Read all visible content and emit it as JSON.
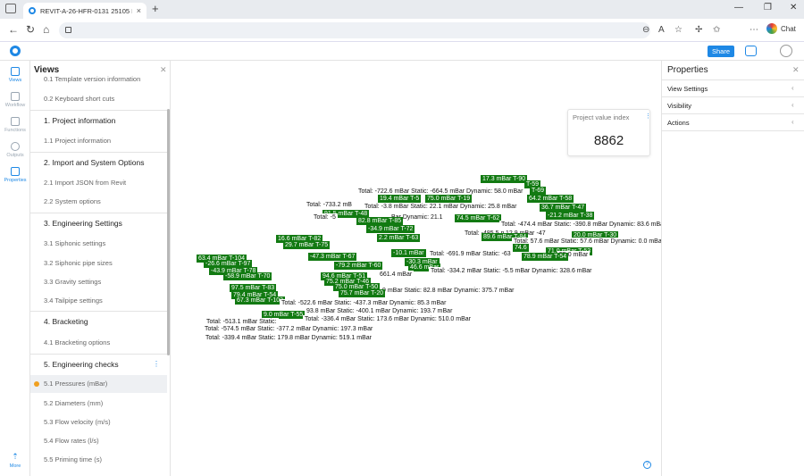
{
  "browser": {
    "tab_title": "REVIT-A-26-HFR-0131 25105 IGEB",
    "tab_close": "×",
    "new_tab": "+",
    "chat_label": "Chat"
  },
  "app": {
    "share_label": "Share"
  },
  "rail": [
    {
      "label": "Views",
      "active": true
    },
    {
      "label": "Workflow",
      "active": false
    },
    {
      "label": "Functions",
      "active": false
    },
    {
      "label": "Outputs",
      "active": false
    },
    {
      "label": "Properties",
      "active": true
    },
    {
      "label": "More",
      "active": true
    }
  ],
  "views": {
    "title": "Views",
    "items": [
      {
        "kind": "item",
        "label": "0.1 Template version information"
      },
      {
        "kind": "item",
        "label": "0.2 Keyboard short cuts"
      },
      {
        "kind": "section",
        "label": "1. Project information"
      },
      {
        "kind": "item",
        "label": "1.1 Project information"
      },
      {
        "kind": "section",
        "label": "2. Import and System Options"
      },
      {
        "kind": "item",
        "label": "2.1 Import JSON from Revit"
      },
      {
        "kind": "item",
        "label": "2.2 System options"
      },
      {
        "kind": "section",
        "label": "3. Engineering Settings"
      },
      {
        "kind": "item",
        "label": "3.1 Siphonic settings"
      },
      {
        "kind": "item",
        "label": "3.2 Siphonic pipe sizes"
      },
      {
        "kind": "item",
        "label": "3.3 Gravity settings"
      },
      {
        "kind": "item",
        "label": "3.4 Tailpipe settings"
      },
      {
        "kind": "section",
        "label": "4. Bracketing"
      },
      {
        "kind": "item",
        "label": "4.1 Bracketing options"
      },
      {
        "kind": "section",
        "label": "5. Engineering checks",
        "menu": true
      },
      {
        "kind": "item",
        "label": "5.1 Pressures (mBar)",
        "active": true
      },
      {
        "kind": "item",
        "label": "5.2 Diameters (mm)"
      },
      {
        "kind": "item",
        "label": "5.3 Flow velocity (m/s)"
      },
      {
        "kind": "item",
        "label": "5.4 Flow rates (l/s)"
      },
      {
        "kind": "item",
        "label": "5.5 Priming time (s)"
      }
    ]
  },
  "kpi": {
    "title": "Project value index",
    "value": "8862"
  },
  "properties": {
    "title": "Properties",
    "rows": [
      "View Settings",
      "Visibility",
      "Actions"
    ]
  },
  "canvas_labels": [
    {
      "t": "g",
      "text": "17.3 mBar T-90"
    },
    {
      "t": "g",
      "text": "T-59"
    },
    {
      "t": "w",
      "text": "Total: -722.6 mBar Static: -664.5 mBar Dynamic: 58.0 mBar"
    },
    {
      "t": "g",
      "text": "T-69"
    },
    {
      "t": "g",
      "text": "19.4 mBar T-5"
    },
    {
      "t": "g",
      "text": "75.0 mBar T-19"
    },
    {
      "t": "g",
      "text": "64.2 mBar T-58"
    },
    {
      "t": "w",
      "text": "Total: -733.2 mB"
    },
    {
      "t": "w",
      "text": "Total: -3.8 mBar Static: 22.1 mBar Dynamic: 25.8 mBar"
    },
    {
      "t": "g",
      "text": "36.7 mBar T-47"
    },
    {
      "t": "g",
      "text": "91.5 mBar T-48"
    },
    {
      "t": "g",
      "text": "-21.2 mBar T-38"
    },
    {
      "t": "w",
      "text": "Total: -5"
    },
    {
      "t": "w",
      "text": "Bar Dynamic: 21.1"
    },
    {
      "t": "g",
      "text": "74.5 mBar T-62"
    },
    {
      "t": "g",
      "text": "82.8 mBar T-85"
    },
    {
      "t": "w",
      "text": "Total: -474.4 mBar Static: -390.8 mBar Dynamic: 83.6 mBar"
    },
    {
      "t": "g",
      "text": "-34.9 mBar T-72"
    },
    {
      "t": "w",
      "text": "Total: -485.5 mBar Static: -47"
    },
    {
      "t": "w",
      "text": "12.9 mBar"
    },
    {
      "t": "g",
      "text": "20.0 mBar T-30"
    },
    {
      "t": "g",
      "text": "89.6 mBar T-84"
    },
    {
      "t": "g",
      "text": "2.2 mBar T-63"
    },
    {
      "t": "w",
      "text": "Total: 57.6 mBar Static: 57.6 mBar Dynamic: 0.0 mBar"
    },
    {
      "t": "g",
      "text": "16.6 mBar T-82"
    },
    {
      "t": "g",
      "text": "29.7 mBar T-75"
    },
    {
      "t": "g",
      "text": "74.6"
    },
    {
      "t": "g",
      "text": "71.0 mBar T-53"
    },
    {
      "t": "g",
      "text": "-10.1 mBar"
    },
    {
      "t": "w",
      "text": "Total: -691.9 mBar Static: -63"
    },
    {
      "t": "w",
      "text": "55.0 mBar"
    },
    {
      "t": "g",
      "text": "78.9 mBar T-54"
    },
    {
      "t": "g",
      "text": "-47.3 mBar T-67"
    },
    {
      "t": "g",
      "text": "-30.3 mBar"
    },
    {
      "t": "g",
      "text": "63.4 mBar T-104"
    },
    {
      "t": "g",
      "text": "46.6 mBar"
    },
    {
      "t": "w",
      "text": "Total: -334.2 mBar Static: -5.5 mBar Dynamic: 328.6 mBar"
    },
    {
      "t": "g",
      "text": "-26.6 mBar T-97"
    },
    {
      "t": "g",
      "text": "-79.2 mBar T-60"
    },
    {
      "t": "w",
      "text": "661.4 mBar"
    },
    {
      "t": "g",
      "text": "-43.9 mBar T-78"
    },
    {
      "t": "g",
      "text": "-58.9 mBar T-70"
    },
    {
      "t": "g",
      "text": "94.6 mBar T-51"
    },
    {
      "t": "g",
      "text": "75.2 mBar T-46"
    },
    {
      "t": "g",
      "text": "97.5 mBar T-83"
    },
    {
      "t": "g",
      "text": "75.0 mBar T-50"
    },
    {
      "t": "w",
      "text": "9 mBar Static: 82.8 mBar Dynamic: 375.7 mBar"
    },
    {
      "t": "g",
      "text": "75.7 mBar T-20"
    },
    {
      "t": "g",
      "text": "79.4 mBar T-54"
    },
    {
      "t": "g",
      "text": "67.3 mBar T-103"
    },
    {
      "t": "w",
      "text": "Total: -522.6 mBar Static: -437.3 mBar Dynamic: 85.3 mBar"
    },
    {
      "t": "g",
      "text": "9.0 mBar T-55"
    },
    {
      "t": "w",
      "text": "93.8 mBar Static: -400.1 mBar Dynamic: 193.7 mBar"
    },
    {
      "t": "w",
      "text": "Total: -336.4 mBar Static: 173.6 mBar Dynamic: 510.0 mBar"
    },
    {
      "t": "w",
      "text": "Total: -513.1 mBar Static:"
    },
    {
      "t": "w",
      "text": "Total: -574.5 mBar Static: -377.2 mBar Dynamic: 197.3 mBar"
    },
    {
      "t": "w",
      "text": "Total: -339.4 mBar Static: 179.8 mBar Dynamic: 519.1 mBar"
    }
  ]
}
